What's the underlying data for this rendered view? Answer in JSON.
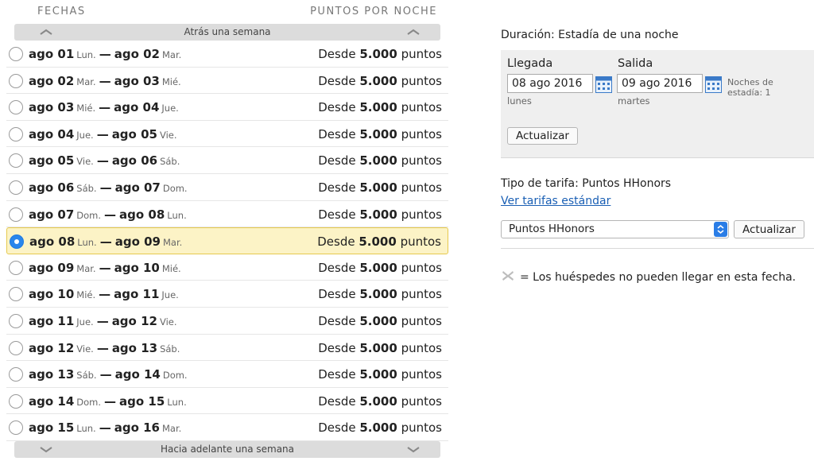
{
  "headers": {
    "fechas": "FECHAS",
    "puntos": "PUNTOS POR NOCHE"
  },
  "nav": {
    "prev_label": "Atrás una semana",
    "next_label": "Hacia adelante una semana"
  },
  "rows": [
    {
      "d1": "ago 01",
      "w1": "Lun.",
      "d2": "ago 02",
      "w2": "Mar.",
      "pre": "Desde",
      "pts": "5.000",
      "unit": "puntos",
      "selected": false
    },
    {
      "d1": "ago 02",
      "w1": "Mar.",
      "d2": "ago 03",
      "w2": "Mié.",
      "pre": "Desde",
      "pts": "5.000",
      "unit": "puntos",
      "selected": false
    },
    {
      "d1": "ago 03",
      "w1": "Mié.",
      "d2": "ago 04",
      "w2": "Jue.",
      "pre": "Desde",
      "pts": "5.000",
      "unit": "puntos",
      "selected": false
    },
    {
      "d1": "ago 04",
      "w1": "Jue.",
      "d2": "ago 05",
      "w2": "Vie.",
      "pre": "Desde",
      "pts": "5.000",
      "unit": "puntos",
      "selected": false
    },
    {
      "d1": "ago 05",
      "w1": "Vie.",
      "d2": "ago 06",
      "w2": "Sáb.",
      "pre": "Desde",
      "pts": "5.000",
      "unit": "puntos",
      "selected": false
    },
    {
      "d1": "ago 06",
      "w1": "Sáb.",
      "d2": "ago 07",
      "w2": "Dom.",
      "pre": "Desde",
      "pts": "5.000",
      "unit": "puntos",
      "selected": false
    },
    {
      "d1": "ago 07",
      "w1": "Dom.",
      "d2": "ago 08",
      "w2": "Lun.",
      "pre": "Desde",
      "pts": "5.000",
      "unit": "puntos",
      "selected": false
    },
    {
      "d1": "ago 08",
      "w1": "Lun.",
      "d2": "ago 09",
      "w2": "Mar.",
      "pre": "Desde",
      "pts": "5.000",
      "unit": "puntos",
      "selected": true
    },
    {
      "d1": "ago 09",
      "w1": "Mar.",
      "d2": "ago 10",
      "w2": "Mié.",
      "pre": "Desde",
      "pts": "5.000",
      "unit": "puntos",
      "selected": false
    },
    {
      "d1": "ago 10",
      "w1": "Mié.",
      "d2": "ago 11",
      "w2": "Jue.",
      "pre": "Desde",
      "pts": "5.000",
      "unit": "puntos",
      "selected": false
    },
    {
      "d1": "ago 11",
      "w1": "Jue.",
      "d2": "ago 12",
      "w2": "Vie.",
      "pre": "Desde",
      "pts": "5.000",
      "unit": "puntos",
      "selected": false
    },
    {
      "d1": "ago 12",
      "w1": "Vie.",
      "d2": "ago 13",
      "w2": "Sáb.",
      "pre": "Desde",
      "pts": "5.000",
      "unit": "puntos",
      "selected": false
    },
    {
      "d1": "ago 13",
      "w1": "Sáb.",
      "d2": "ago 14",
      "w2": "Dom.",
      "pre": "Desde",
      "pts": "5.000",
      "unit": "puntos",
      "selected": false
    },
    {
      "d1": "ago 14",
      "w1": "Dom.",
      "d2": "ago 15",
      "w2": "Lun.",
      "pre": "Desde",
      "pts": "5.000",
      "unit": "puntos",
      "selected": false
    },
    {
      "d1": "ago 15",
      "w1": "Lun.",
      "d2": "ago 16",
      "w2": "Mar.",
      "pre": "Desde",
      "pts": "5.000",
      "unit": "puntos",
      "selected": false
    }
  ],
  "stay": {
    "duration": "Duración: Estadía de una noche",
    "checkin_label": "Llegada",
    "checkin_value": "08 ago 2016",
    "checkin_day": "lunes",
    "checkout_label": "Salida",
    "checkout_value": "09 ago 2016",
    "checkout_day": "martes",
    "nights_label": "Noches de estadía: 1",
    "update_label": "Actualizar"
  },
  "rate": {
    "type_label": "Tipo de tarifa: Puntos HHonors",
    "standard_link": "Ver tarifas estándar",
    "select_value": "Puntos HHonors",
    "update_label": "Actualizar"
  },
  "legend": {
    "text": "= Los huéspedes no pueden llegar en esta fecha."
  },
  "icons": {
    "calendar": "calendar-icon",
    "unavailable": "x-icon",
    "select_arrows": "select-arrows-icon"
  },
  "colors": {
    "accent": "#2a86ec",
    "selected_row_bg": "#fcf3c6",
    "link": "#1a5fb4"
  }
}
